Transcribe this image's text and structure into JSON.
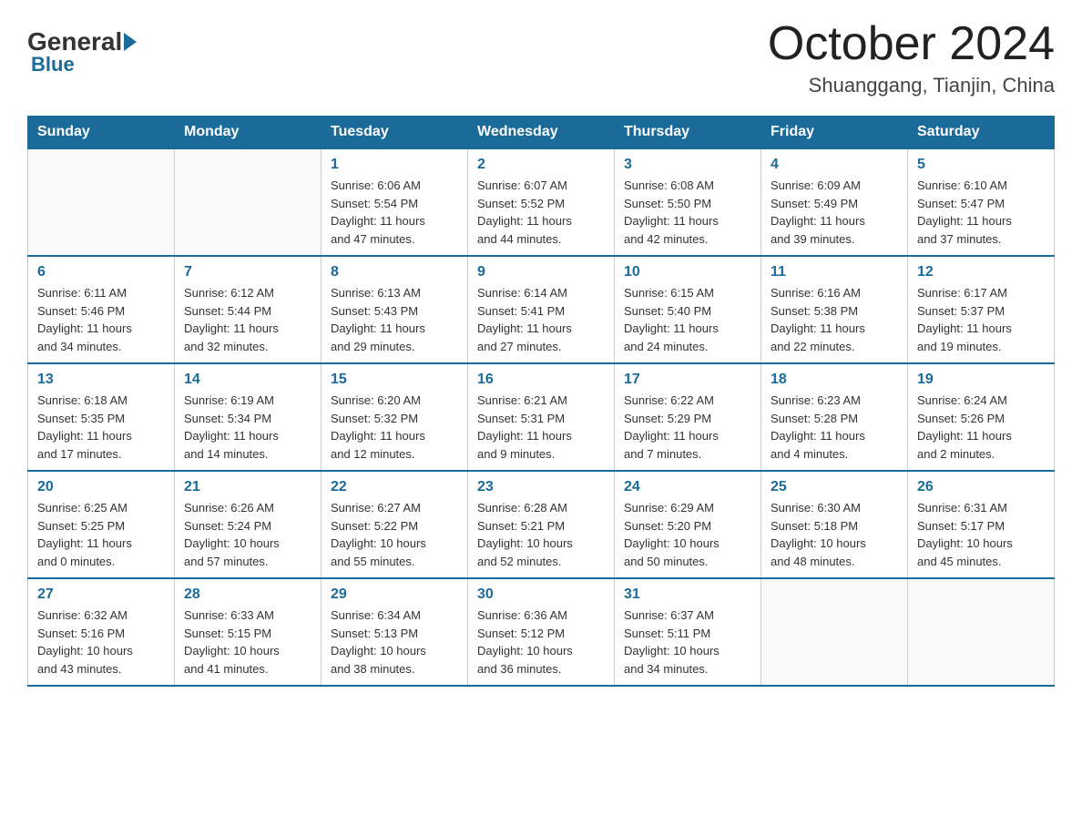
{
  "header": {
    "logo_general": "General",
    "logo_blue": "Blue",
    "month_year": "October 2024",
    "location": "Shuanggang, Tianjin, China"
  },
  "weekdays": [
    "Sunday",
    "Monday",
    "Tuesday",
    "Wednesday",
    "Thursday",
    "Friday",
    "Saturday"
  ],
  "weeks": [
    [
      {
        "day": "",
        "info": ""
      },
      {
        "day": "",
        "info": ""
      },
      {
        "day": "1",
        "info": "Sunrise: 6:06 AM\nSunset: 5:54 PM\nDaylight: 11 hours\nand 47 minutes."
      },
      {
        "day": "2",
        "info": "Sunrise: 6:07 AM\nSunset: 5:52 PM\nDaylight: 11 hours\nand 44 minutes."
      },
      {
        "day": "3",
        "info": "Sunrise: 6:08 AM\nSunset: 5:50 PM\nDaylight: 11 hours\nand 42 minutes."
      },
      {
        "day": "4",
        "info": "Sunrise: 6:09 AM\nSunset: 5:49 PM\nDaylight: 11 hours\nand 39 minutes."
      },
      {
        "day": "5",
        "info": "Sunrise: 6:10 AM\nSunset: 5:47 PM\nDaylight: 11 hours\nand 37 minutes."
      }
    ],
    [
      {
        "day": "6",
        "info": "Sunrise: 6:11 AM\nSunset: 5:46 PM\nDaylight: 11 hours\nand 34 minutes."
      },
      {
        "day": "7",
        "info": "Sunrise: 6:12 AM\nSunset: 5:44 PM\nDaylight: 11 hours\nand 32 minutes."
      },
      {
        "day": "8",
        "info": "Sunrise: 6:13 AM\nSunset: 5:43 PM\nDaylight: 11 hours\nand 29 minutes."
      },
      {
        "day": "9",
        "info": "Sunrise: 6:14 AM\nSunset: 5:41 PM\nDaylight: 11 hours\nand 27 minutes."
      },
      {
        "day": "10",
        "info": "Sunrise: 6:15 AM\nSunset: 5:40 PM\nDaylight: 11 hours\nand 24 minutes."
      },
      {
        "day": "11",
        "info": "Sunrise: 6:16 AM\nSunset: 5:38 PM\nDaylight: 11 hours\nand 22 minutes."
      },
      {
        "day": "12",
        "info": "Sunrise: 6:17 AM\nSunset: 5:37 PM\nDaylight: 11 hours\nand 19 minutes."
      }
    ],
    [
      {
        "day": "13",
        "info": "Sunrise: 6:18 AM\nSunset: 5:35 PM\nDaylight: 11 hours\nand 17 minutes."
      },
      {
        "day": "14",
        "info": "Sunrise: 6:19 AM\nSunset: 5:34 PM\nDaylight: 11 hours\nand 14 minutes."
      },
      {
        "day": "15",
        "info": "Sunrise: 6:20 AM\nSunset: 5:32 PM\nDaylight: 11 hours\nand 12 minutes."
      },
      {
        "day": "16",
        "info": "Sunrise: 6:21 AM\nSunset: 5:31 PM\nDaylight: 11 hours\nand 9 minutes."
      },
      {
        "day": "17",
        "info": "Sunrise: 6:22 AM\nSunset: 5:29 PM\nDaylight: 11 hours\nand 7 minutes."
      },
      {
        "day": "18",
        "info": "Sunrise: 6:23 AM\nSunset: 5:28 PM\nDaylight: 11 hours\nand 4 minutes."
      },
      {
        "day": "19",
        "info": "Sunrise: 6:24 AM\nSunset: 5:26 PM\nDaylight: 11 hours\nand 2 minutes."
      }
    ],
    [
      {
        "day": "20",
        "info": "Sunrise: 6:25 AM\nSunset: 5:25 PM\nDaylight: 11 hours\nand 0 minutes."
      },
      {
        "day": "21",
        "info": "Sunrise: 6:26 AM\nSunset: 5:24 PM\nDaylight: 10 hours\nand 57 minutes."
      },
      {
        "day": "22",
        "info": "Sunrise: 6:27 AM\nSunset: 5:22 PM\nDaylight: 10 hours\nand 55 minutes."
      },
      {
        "day": "23",
        "info": "Sunrise: 6:28 AM\nSunset: 5:21 PM\nDaylight: 10 hours\nand 52 minutes."
      },
      {
        "day": "24",
        "info": "Sunrise: 6:29 AM\nSunset: 5:20 PM\nDaylight: 10 hours\nand 50 minutes."
      },
      {
        "day": "25",
        "info": "Sunrise: 6:30 AM\nSunset: 5:18 PM\nDaylight: 10 hours\nand 48 minutes."
      },
      {
        "day": "26",
        "info": "Sunrise: 6:31 AM\nSunset: 5:17 PM\nDaylight: 10 hours\nand 45 minutes."
      }
    ],
    [
      {
        "day": "27",
        "info": "Sunrise: 6:32 AM\nSunset: 5:16 PM\nDaylight: 10 hours\nand 43 minutes."
      },
      {
        "day": "28",
        "info": "Sunrise: 6:33 AM\nSunset: 5:15 PM\nDaylight: 10 hours\nand 41 minutes."
      },
      {
        "day": "29",
        "info": "Sunrise: 6:34 AM\nSunset: 5:13 PM\nDaylight: 10 hours\nand 38 minutes."
      },
      {
        "day": "30",
        "info": "Sunrise: 6:36 AM\nSunset: 5:12 PM\nDaylight: 10 hours\nand 36 minutes."
      },
      {
        "day": "31",
        "info": "Sunrise: 6:37 AM\nSunset: 5:11 PM\nDaylight: 10 hours\nand 34 minutes."
      },
      {
        "day": "",
        "info": ""
      },
      {
        "day": "",
        "info": ""
      }
    ]
  ]
}
